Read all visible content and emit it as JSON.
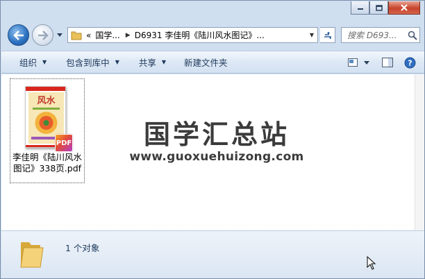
{
  "addressbar": {
    "chevrons": "«",
    "crumbs": [
      "国学...",
      "D6931 李佳明《陆川风水图记》..."
    ]
  },
  "search": {
    "placeholder": "搜索 D693..."
  },
  "toolbar": {
    "items": [
      {
        "label": "组织",
        "has_dropdown": true
      },
      {
        "label": "包含到库中",
        "has_dropdown": true
      },
      {
        "label": "共享",
        "has_dropdown": true
      },
      {
        "label": "新建文件夹",
        "has_dropdown": false
      }
    ]
  },
  "files": [
    {
      "name": "李佳明《陆川风水图记》338页.pdf",
      "type": "pdf",
      "badge": "PDF",
      "thumb_text": "风水"
    }
  ],
  "watermark": {
    "title": "国学汇总站",
    "url": "www.guoxuehuizong.com"
  },
  "details": {
    "item_count": "1 个对象"
  },
  "colors": {
    "frame": "#cfdff0",
    "toolbar_text": "#1e395b",
    "pdf_badge": "#e24a3b",
    "thumb_header": "#d9261c"
  },
  "icons": [
    "back-arrow-icon",
    "forward-arrow-icon",
    "folder-icon",
    "refresh-icon",
    "search-icon",
    "view-options-icon",
    "preview-pane-icon",
    "help-icon",
    "pdf-icon",
    "mouse-cursor-icon"
  ]
}
